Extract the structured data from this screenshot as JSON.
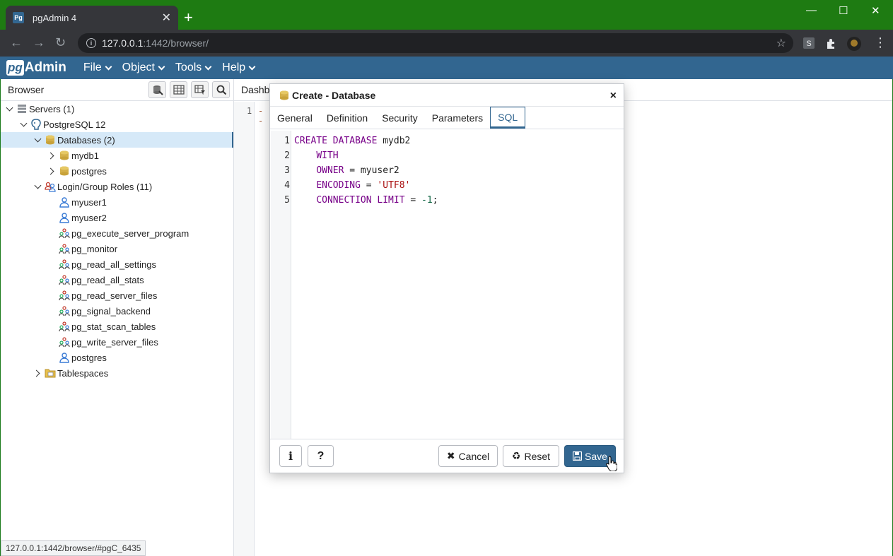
{
  "chrome": {
    "tab_title": "pgAdmin 4",
    "favicon_text": "Pg",
    "new_tab": "+",
    "url_host": "127.0.0.1",
    "url_path": ":1442/browser/",
    "window_controls": [
      "—",
      "☐",
      "✕"
    ]
  },
  "navbar": {
    "logo_pg": "pg",
    "logo_admin": "Admin",
    "menus": [
      "File",
      "Object",
      "Tools",
      "Help"
    ]
  },
  "browser": {
    "title": "Browser",
    "tree": [
      {
        "label": "Servers (1)",
        "indent": 0,
        "state": "down",
        "icon": "servers-icon"
      },
      {
        "label": "PostgreSQL 12",
        "indent": 1,
        "state": "down",
        "icon": "postgres-server-icon"
      },
      {
        "label": "Databases (2)",
        "indent": 2,
        "state": "down",
        "icon": "databases-icon",
        "selected": true
      },
      {
        "label": "mydb1",
        "indent": 3,
        "state": "right",
        "icon": "database-icon"
      },
      {
        "label": "postgres",
        "indent": 3,
        "state": "right",
        "icon": "database-icon"
      },
      {
        "label": "Login/Group Roles (11)",
        "indent": 2,
        "state": "down",
        "icon": "roles-icon"
      },
      {
        "label": "myuser1",
        "indent": 3,
        "state": "none",
        "icon": "user-icon"
      },
      {
        "label": "myuser2",
        "indent": 3,
        "state": "none",
        "icon": "user-icon"
      },
      {
        "label": "pg_execute_server_program",
        "indent": 3,
        "state": "none",
        "icon": "group-role-icon"
      },
      {
        "label": "pg_monitor",
        "indent": 3,
        "state": "none",
        "icon": "group-role-icon"
      },
      {
        "label": "pg_read_all_settings",
        "indent": 3,
        "state": "none",
        "icon": "group-role-icon"
      },
      {
        "label": "pg_read_all_stats",
        "indent": 3,
        "state": "none",
        "icon": "group-role-icon"
      },
      {
        "label": "pg_read_server_files",
        "indent": 3,
        "state": "none",
        "icon": "group-role-icon"
      },
      {
        "label": "pg_signal_backend",
        "indent": 3,
        "state": "none",
        "icon": "group-role-icon"
      },
      {
        "label": "pg_stat_scan_tables",
        "indent": 3,
        "state": "none",
        "icon": "group-role-icon"
      },
      {
        "label": "pg_write_server_files",
        "indent": 3,
        "state": "none",
        "icon": "group-role-icon"
      },
      {
        "label": "postgres",
        "indent": 3,
        "state": "none",
        "icon": "user-icon"
      },
      {
        "label": "Tablespaces",
        "indent": 2,
        "state": "right",
        "icon": "tablespaces-icon"
      }
    ]
  },
  "status_url": "127.0.0.1:1442/browser/#pgC_6435",
  "main": {
    "tab_label": "Dashb",
    "editor_line": "1",
    "editor_text": "--"
  },
  "dialog": {
    "title": "Create - Database",
    "close": "×",
    "tabs": [
      "General",
      "Definition",
      "Security",
      "Parameters",
      "SQL"
    ],
    "active_tab": "SQL",
    "sql_lines": [
      [
        {
          "t": "kw",
          "v": "CREATE DATABASE"
        },
        {
          "t": "id",
          "v": " mydb2"
        }
      ],
      [
        {
          "t": "id",
          "v": "    "
        },
        {
          "t": "kw",
          "v": "WITH"
        }
      ],
      [
        {
          "t": "id",
          "v": "    "
        },
        {
          "t": "kw",
          "v": "OWNER"
        },
        {
          "t": "id",
          "v": " = myuser2"
        }
      ],
      [
        {
          "t": "id",
          "v": "    "
        },
        {
          "t": "kw",
          "v": "ENCODING"
        },
        {
          "t": "id",
          "v": " = "
        },
        {
          "t": "str",
          "v": "'UTF8'"
        }
      ],
      [
        {
          "t": "id",
          "v": "    "
        },
        {
          "t": "kw",
          "v": "CONNECTION LIMIT"
        },
        {
          "t": "id",
          "v": " = "
        },
        {
          "t": "num",
          "v": "-1"
        },
        {
          "t": "id",
          "v": ";"
        }
      ]
    ],
    "buttons": {
      "info": "i",
      "help": "?",
      "cancel": "Cancel",
      "reset": "Reset",
      "save": "Save"
    }
  },
  "colors": {
    "accent": "#326690",
    "selected_row": "#d6e9f8",
    "chrome_frame": "#1e7b12"
  }
}
